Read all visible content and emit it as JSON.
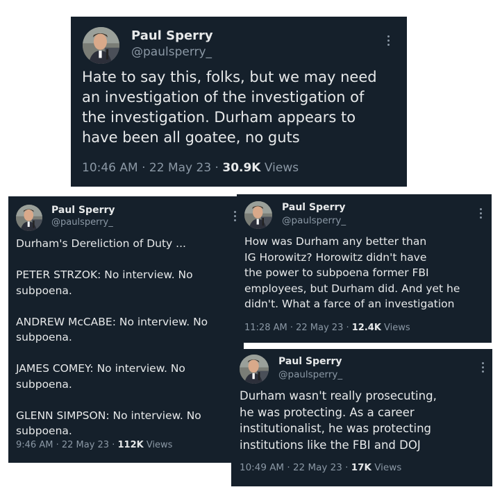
{
  "tweets": [
    {
      "name": "Paul Sperry",
      "handle": "@paulsperry_",
      "text": "Hate to say this, folks, but we may need\nan investigation of the investigation of\nthe investigation. Durham appears to\nhave been all goatee, no guts",
      "time": "10:46 AM",
      "sep1": " · ",
      "date": "22 May 23",
      "sep2": " · ",
      "views_count": "30.9K",
      "views_label": " Views"
    },
    {
      "name": "Paul Sperry",
      "handle": "@paulsperry_",
      "text": "Durham's Dereliction of Duty ...\n\nPETER STRZOK: No interview. No\nsubpoena.\n\nANDREW McCABE: No interview. No\nsubpoena.\n\nJAMES COMEY: No interview. No\nsubpoena.\n\nGLENN SIMPSON: No interview. No\nsubpoena.",
      "time": "9:46 AM",
      "sep1": " · ",
      "date": "22 May 23",
      "sep2": " · ",
      "views_count": "112K",
      "views_label": " Views"
    },
    {
      "name": "Paul Sperry",
      "handle": "@paulsperry_",
      "text": "How was Durham any better than\nIG Horowitz? Horowitz didn't have\nthe power to subpoena former FBI\nemployees, but Durham did. And yet he\ndidn't. What a farce of an investigation",
      "time": "11:28 AM",
      "sep1": " · ",
      "date": "22 May 23",
      "sep2": " · ",
      "views_count": "12.4K",
      "views_label": " Views"
    },
    {
      "name": "Paul Sperry",
      "handle": "@paulsperry_",
      "text": "Durham wasn't really prosecuting,\nhe was protecting. As a career\ninstitutionalist, he was protecting\ninstitutions like the FBI and DOJ",
      "time": "10:49 AM",
      "sep1": " · ",
      "date": "22 May 23",
      "sep2": " · ",
      "views_count": "17K",
      "views_label": " Views"
    }
  ],
  "colors": {
    "card_background": "#15202b",
    "primary_text": "#e7e9ea",
    "secondary_text": "#8b98a5",
    "page_background": "#ffffff"
  },
  "icons": {
    "more": "more-vertical-icon",
    "avatar": "avatar"
  }
}
